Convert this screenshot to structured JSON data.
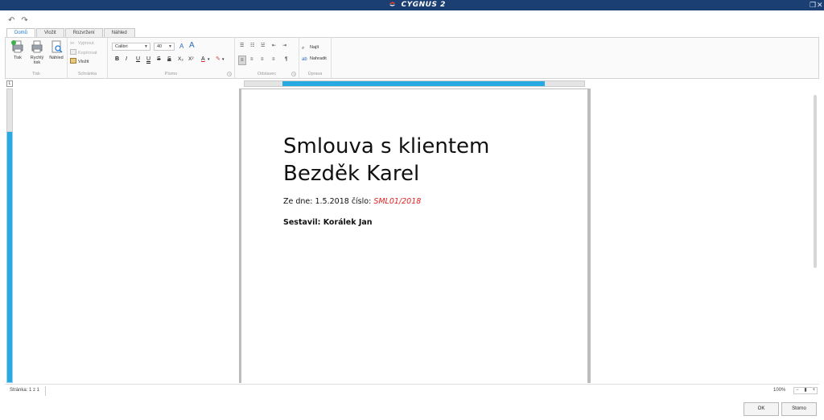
{
  "window": {
    "brand": "CYGNUS 2",
    "restore_icon": "restore-icon",
    "close_icon": "close-icon"
  },
  "quick_access": {
    "undo_icon": "undo-icon",
    "redo_icon": "redo-icon"
  },
  "tabs": [
    {
      "label": "Domů",
      "active": true
    },
    {
      "label": "Vložit",
      "active": false
    },
    {
      "label": "Rozvržení",
      "active": false
    },
    {
      "label": "Náhled",
      "active": false
    }
  ],
  "ribbon": {
    "tisk": {
      "label": "Tisk",
      "print_label": "Tisk",
      "quick_print_label": "Rychlý tisk",
      "preview_label": "Náhled"
    },
    "schranka": {
      "label": "Schránka",
      "cut_label": "Vyjmout",
      "copy_label": "Kopírovat",
      "paste_label": "Vložit"
    },
    "pismo": {
      "label": "Písmo",
      "font_name": "Calibri",
      "font_size": "40",
      "bold": "B",
      "italic": "I",
      "underline": "U",
      "double_underline": "U",
      "strike": "S",
      "double_strike": "S",
      "subscript": "X₂",
      "superscript": "X²",
      "font_color": "A",
      "grow": "A",
      "shrink": "A"
    },
    "odstavec": {
      "label": "Odstavec"
    },
    "uprava": {
      "label": "Úprava",
      "find_label": "Najít",
      "replace_label": "Nahradit"
    }
  },
  "ruler": {
    "corner": "L"
  },
  "document": {
    "title_line1": "Smlouva s klientem",
    "title_line2": "Bezděk Karel",
    "date_prefix": "Ze dne: 1.5.2018 číslo: ",
    "contract_number": "SML01/2018",
    "author_label": "Sestavil:",
    "author_name": "Korálek Jan"
  },
  "status": {
    "page": "Stránka: 1 z 1",
    "zoom": "100%"
  },
  "buttons": {
    "ok": "OK",
    "cancel": "Storno"
  },
  "colors": {
    "titlebar": "#1b3f73",
    "ruler_accent": "#27aae1",
    "contract_number": "#e02020",
    "active_tab": "#1a73c7"
  }
}
